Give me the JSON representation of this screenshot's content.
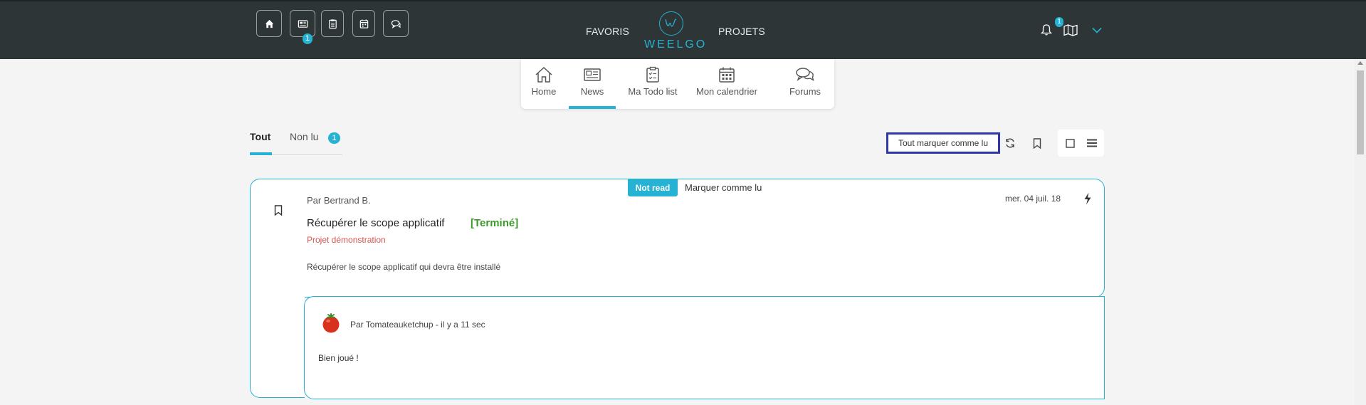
{
  "header": {
    "quick_buttons": [
      {
        "icon": "home-icon"
      },
      {
        "icon": "newspaper-icon",
        "badge": "1"
      },
      {
        "icon": "clipboard-icon"
      },
      {
        "icon": "calendar-icon"
      },
      {
        "icon": "chat-icon"
      }
    ],
    "nav_left": "FAVORIS",
    "nav_right": "PROJETS",
    "logo_text": "WEELGO",
    "bell_badge": "1",
    "accent_color": "#25b2d3"
  },
  "subnav": {
    "items": [
      {
        "label": "Home",
        "icon": "home-icon"
      },
      {
        "label": "News",
        "icon": "newspaper-icon",
        "active": true
      },
      {
        "label": "Ma Todo list",
        "icon": "clipboard-icon"
      },
      {
        "label": "Mon calendrier",
        "icon": "calendar-icon"
      },
      {
        "label": "Forums",
        "icon": "chat-icon"
      }
    ]
  },
  "filters": {
    "tabs": [
      {
        "label": "Tout",
        "active": true
      },
      {
        "label": "Non lu",
        "badge": "1"
      }
    ]
  },
  "actions": {
    "mark_all_label": "Tout marquer comme lu"
  },
  "news": {
    "status_badge": "Not read",
    "mark_read_label": "Marquer comme lu",
    "author": "Par Bertrand B.",
    "date": "mer. 04 juil. 18",
    "title": "Récupérer le scope applicatif",
    "status": "[Terminé]",
    "status_color": "#3d9a2a",
    "project": "Projet démonstration",
    "project_color": "#d9534f",
    "description": "Récupérer le scope applicatif qui devra être installé",
    "comment": {
      "author": "Par Tomateauketchup - il y a 11 sec",
      "text": "Bien joué !"
    }
  }
}
